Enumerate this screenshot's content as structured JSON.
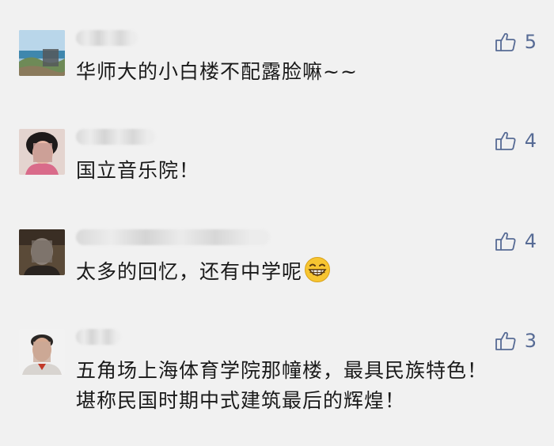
{
  "comments": [
    {
      "text": "华师大的小白楼不配露脸嘛~~",
      "likes": "5",
      "avatar_icon": "landscape-avatar"
    },
    {
      "text": "国立音乐院！",
      "likes": "4",
      "avatar_icon": "person-avatar"
    },
    {
      "text": "太多的回忆，还有中学呢",
      "likes": "4",
      "avatar_icon": "person-avatar",
      "emoji": "grinning-face-icon"
    },
    {
      "text": "五角场上海体育学院那幢楼，最具民族特色！堪称民国时期中式建筑最后的辉煌！",
      "likes": "3",
      "avatar_icon": "person-avatar"
    }
  ],
  "colors": {
    "like_blue": "#576b95",
    "background": "#f1f1f1",
    "text": "#1a1a1a"
  },
  "icons": {
    "like": "thumbs-up-icon"
  }
}
